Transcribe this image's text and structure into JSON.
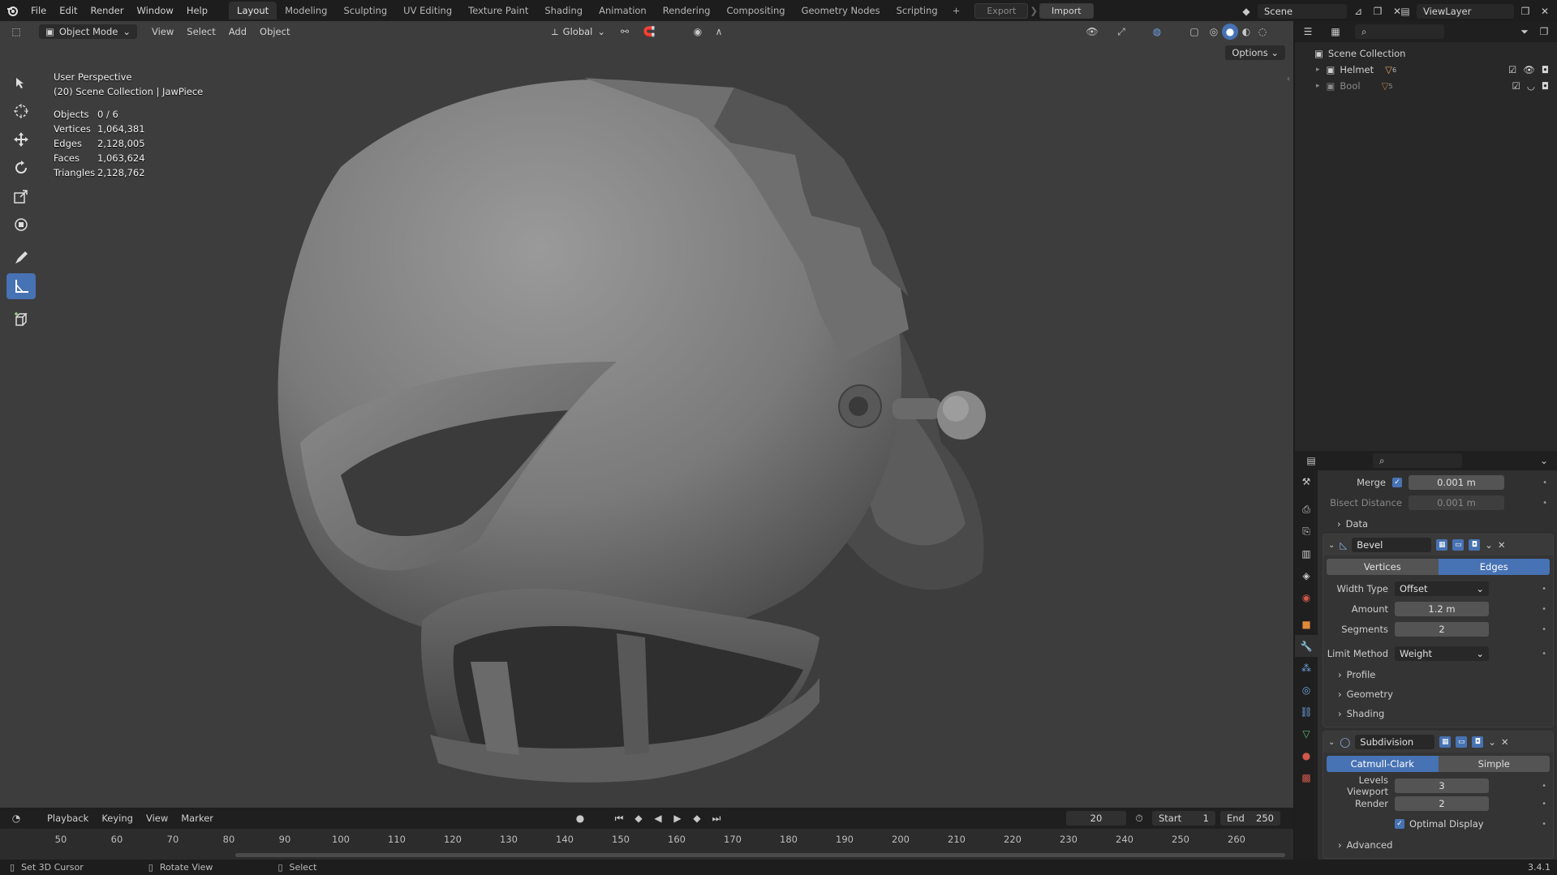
{
  "topbar": {
    "menus": [
      "File",
      "Edit",
      "Render",
      "Window",
      "Help"
    ],
    "workspaces": [
      "Layout",
      "Modeling",
      "Sculpting",
      "UV Editing",
      "Texture Paint",
      "Shading",
      "Animation",
      "Rendering",
      "Compositing",
      "Geometry Nodes",
      "Scripting"
    ],
    "active_workspace": "Layout",
    "add_tab": "+",
    "export_label": "Export",
    "import_label": "Import",
    "scene_name": "Scene",
    "view_layer_name": "ViewLayer"
  },
  "viewport": {
    "mode": "Object Mode",
    "menus": [
      "View",
      "Select",
      "Add",
      "Object"
    ],
    "transform_orientation": "Global",
    "options_label": "Options",
    "perspective_label": "User Perspective",
    "collection_label": "(20) Scene Collection | JawPiece",
    "stats": [
      {
        "key": "Objects",
        "value": "0 / 6"
      },
      {
        "key": "Vertices",
        "value": "1,064,381"
      },
      {
        "key": "Edges",
        "value": "2,128,005"
      },
      {
        "key": "Faces",
        "value": "1,063,624"
      },
      {
        "key": "Triangles",
        "value": "2,128,762"
      }
    ],
    "tools": [
      "select-box-icon",
      "cursor-icon",
      "move-icon",
      "rotate-icon",
      "scale-icon",
      "transform-icon",
      "annotate-icon",
      "measure-icon",
      "add-cube-icon"
    ]
  },
  "timeline": {
    "menus": [
      "Playback",
      "Keying",
      "View",
      "Marker"
    ],
    "current_frame": "20",
    "start_label": "Start",
    "start_value": "1",
    "end_label": "End",
    "end_value": "250",
    "ticks": [
      "50",
      "60",
      "70",
      "80",
      "90",
      "100",
      "110",
      "120",
      "130",
      "140",
      "150",
      "160",
      "170",
      "180",
      "190",
      "200",
      "210",
      "220",
      "230",
      "240",
      "250",
      "260"
    ]
  },
  "statusbar": {
    "items": [
      "Set 3D Cursor",
      "Rotate View",
      "Select"
    ],
    "version": "3.4.1"
  },
  "outliner": {
    "root": "Scene Collection",
    "items": [
      {
        "name": "Helmet",
        "count": "6"
      },
      {
        "name": "Bool",
        "count": "5"
      }
    ]
  },
  "properties": {
    "merge_label": "Merge",
    "merge_value": "0.001 m",
    "bisect_label": "Bisect Distance",
    "bisect_value": "0.001 m",
    "data_label": "Data",
    "bevel": {
      "name": "Bevel",
      "affect_options": [
        "Vertices",
        "Edges"
      ],
      "affect_active": "Edges",
      "width_type_label": "Width Type",
      "width_type_value": "Offset",
      "amount_label": "Amount",
      "amount_value": "1.2 m",
      "segments_label": "Segments",
      "segments_value": "2",
      "limit_label": "Limit Method",
      "limit_value": "Weight",
      "subpanels": [
        "Profile",
        "Geometry",
        "Shading"
      ]
    },
    "subdivision": {
      "name": "Subdivision",
      "type_options": [
        "Catmull-Clark",
        "Simple"
      ],
      "type_active": "Catmull-Clark",
      "levels_label": "Levels Viewport",
      "levels_value": "3",
      "render_label": "Render",
      "render_value": "2",
      "optimal_label": "Optimal Display",
      "advanced_label": "Advanced"
    }
  },
  "colors": {
    "accent": "#4772b3",
    "viewport_bg": "#3d3d3d",
    "panel_bg": "#303030"
  }
}
